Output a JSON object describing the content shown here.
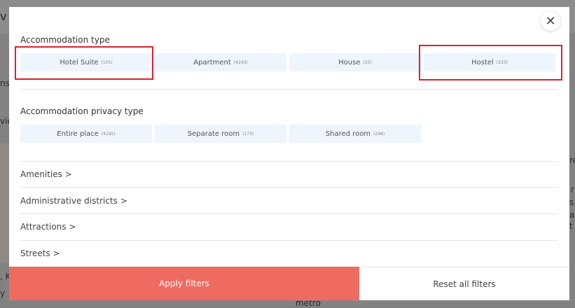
{
  "modal": {
    "close_glyph": "✕",
    "accommodation_type": {
      "title": "Accommodation type",
      "options": [
        {
          "label": "Hotel Suite",
          "count": "(105)"
        },
        {
          "label": "Apartment",
          "count": "(4243)"
        },
        {
          "label": "House",
          "count": "(25)"
        },
        {
          "label": "Hostel",
          "count": "(333)"
        }
      ]
    },
    "privacy_type": {
      "title": "Accommodation privacy type",
      "options": [
        {
          "label": "Entire place",
          "count": "(4295)"
        },
        {
          "label": "Separate room",
          "count": "(173)"
        },
        {
          "label": "Shared room",
          "count": "(298)"
        }
      ]
    },
    "sections": [
      {
        "label": "Amenities >"
      },
      {
        "label": "Administrative districts >"
      },
      {
        "label": "Attractions >"
      },
      {
        "label": "Streets >"
      }
    ],
    "footer": {
      "apply_label": "Apply filters",
      "reset_label": "Reset all filters"
    }
  },
  "background": {
    "top_left": "v",
    "left_1": "nsi",
    "left_2": "vie",
    "bottom_left_1": ", K",
    "bottom_left_2": "y",
    "bottom_mid": "metro",
    "right_1": "re",
    "right_2": "r",
    "right_3": "s",
    "right_4": "a",
    "right_5": "t"
  }
}
